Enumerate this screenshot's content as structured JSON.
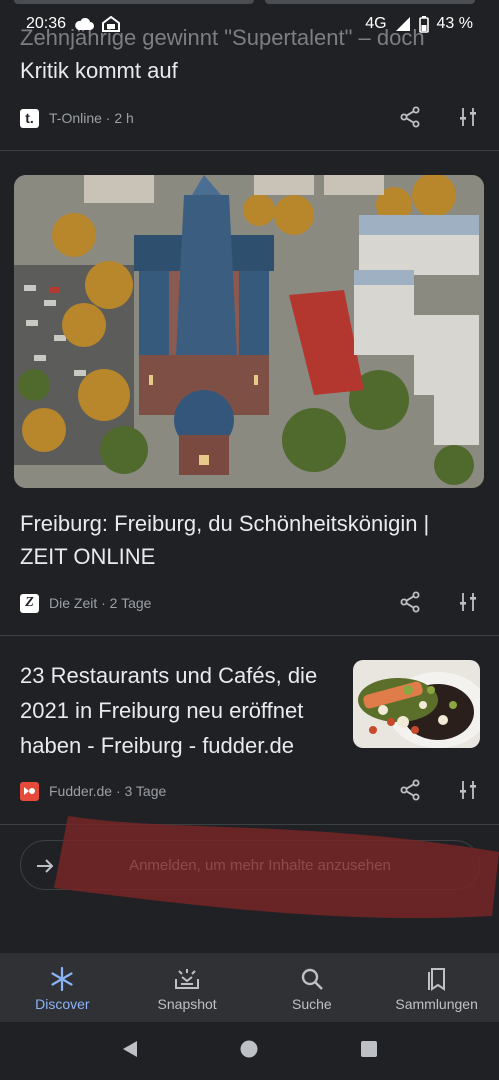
{
  "status_bar": {
    "time": "20:36",
    "network": "4G",
    "battery": "43 %",
    "icons": [
      "cloud-icon",
      "home-icon",
      "signal-icon",
      "battery-icon"
    ]
  },
  "cards": [
    {
      "headline_faded": "Zehnjährige gewinnt \"Supertalent\" – doch",
      "headline": "Kritik kommt auf",
      "source_letter": "t.",
      "source": "T-Online · 2 h"
    },
    {
      "headline_line1": "Freiburg: Freiburg, du Schönheitskönigin |",
      "headline_line2": "ZEIT ONLINE",
      "source_letter": "Z",
      "source": "Die Zeit · 2 Tage",
      "image": "aerial-cathedral-image"
    },
    {
      "headline_line1": "23 Restaurants und Cafés, die",
      "headline_line2": "2021 in Freiburg neu eröffnet",
      "headline_line3": "haben - Freiburg - fudder.de",
      "source": "Fudder.de · 3 Tage",
      "image": "food-plate-image"
    }
  ],
  "signin": {
    "label": "Anmelden, um mehr Inhalte anzusehen"
  },
  "bottom_nav": [
    {
      "label": "Discover",
      "icon": "asterisk-icon",
      "active": true
    },
    {
      "label": "Snapshot",
      "icon": "snapshot-icon",
      "active": false
    },
    {
      "label": "Suche",
      "icon": "search-icon",
      "active": false
    },
    {
      "label": "Sammlungen",
      "icon": "collections-icon",
      "active": false
    }
  ],
  "system_nav": [
    "back-icon",
    "home-icon",
    "recents-icon"
  ],
  "colors": {
    "background": "#202124",
    "accent": "#8ab4f8",
    "nav_background": "#303134",
    "scribble": "#7a2526"
  }
}
